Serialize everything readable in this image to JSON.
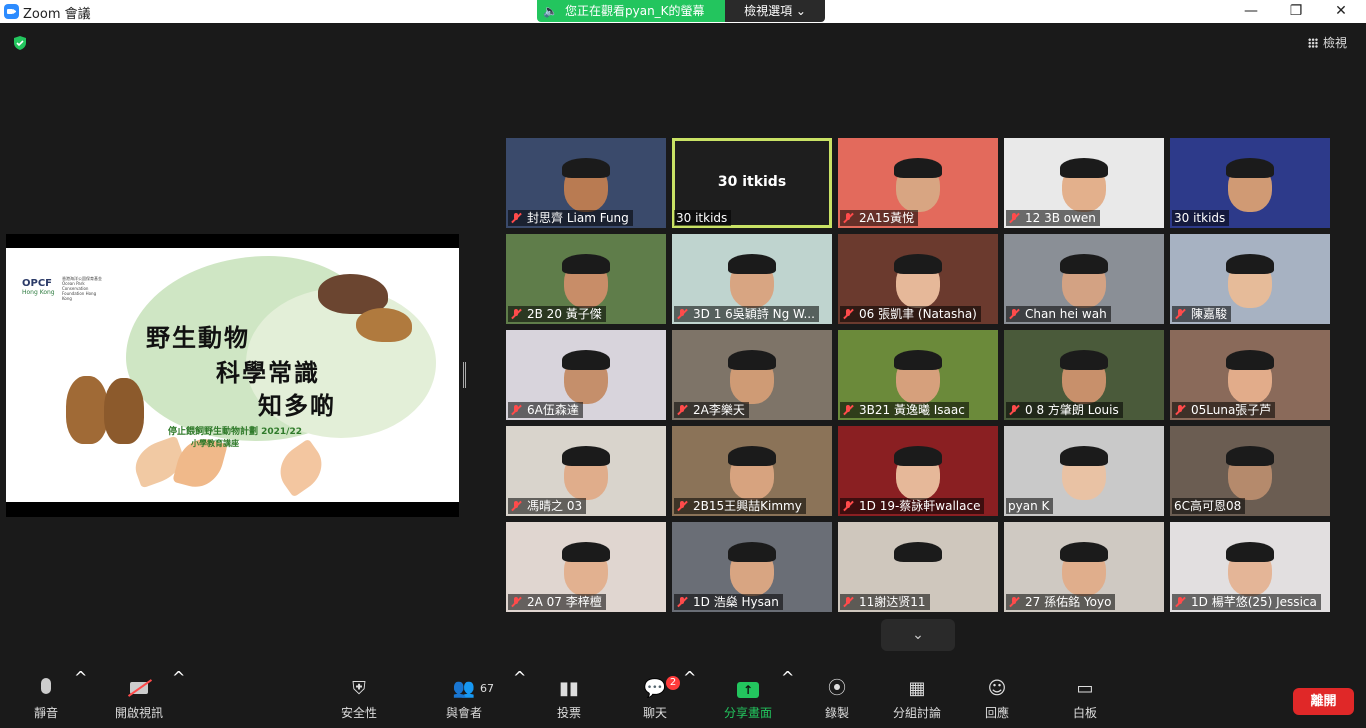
{
  "window": {
    "title": "Zoom 會議",
    "minimize": "—",
    "maximize": "❐",
    "close": "✕"
  },
  "share_banner": {
    "text": "您正在觀看pyan_K的螢幕",
    "view_options": "檢視選項 ⌄"
  },
  "top_right": {
    "view_label": "檢視"
  },
  "slide": {
    "logo": "OPCF",
    "logo_sub": "Hong Kong",
    "logo_org": "香港海洋公園保育基金 Ocean Park Conservation Foundation Hong Kong",
    "title_line1": "野生動物",
    "title_line2": "科學常識",
    "title_line3": "知多啲",
    "subtitle1": "停止餵飼野生動物計劃 2021/22",
    "subtitle2": "小學教育講座"
  },
  "participants": [
    {
      "name": "封思齊 Liam Fung",
      "muted": true,
      "bg": "#3a4a6b",
      "skin": "#b97b52"
    },
    {
      "name": "30 itkids",
      "muted": false,
      "active": true,
      "center_name": "30 itkids",
      "bg": "#1e1e1e"
    },
    {
      "name": "2A15黃悅",
      "muted": true,
      "bg": "#e36a5c",
      "skin": "#d8a582"
    },
    {
      "name": "12 3B owen",
      "muted": true,
      "bg": "#e9e9e9",
      "skin": "#e3b08c"
    },
    {
      "name": "30 itkids",
      "muted": false,
      "bg": "#2d3a8a",
      "skin": "#d09a74"
    },
    {
      "name": "2B 20 黃子傑",
      "muted": true,
      "bg": "#5f7d4a",
      "skin": "#c88d68"
    },
    {
      "name": "3D 1 6吳穎詩 Ng W...",
      "muted": true,
      "bg": "#bfd4cf",
      "skin": "#d8a582"
    },
    {
      "name": "06 張凱聿 (Natasha)",
      "muted": true,
      "bg": "#6b3a2e",
      "skin": "#e6b899"
    },
    {
      "name": "Chan hei wah",
      "muted": true,
      "bg": "#8a8f96",
      "skin": "#d3a283"
    },
    {
      "name": "陳嘉駿",
      "muted": true,
      "bg": "#a7b2c2",
      "skin": "#e6bb99"
    },
    {
      "name": "6A伍森達",
      "muted": true,
      "bg": "#d8d4dc",
      "skin": "#c58f6b"
    },
    {
      "name": "2A李樂天",
      "muted": true,
      "bg": "#7e7468",
      "skin": "#cf9b75"
    },
    {
      "name": "3B21 黃逸曦 Isaac",
      "muted": true,
      "bg": "#6b8a3a",
      "skin": "#d6a07c"
    },
    {
      "name": "0 8 方肇朗 Louis",
      "muted": true,
      "bg": "#4a5a3a",
      "skin": "#c8906b"
    },
    {
      "name": "05Luna張子芦",
      "muted": true,
      "bg": "#8a6a5a",
      "skin": "#e2ac8a"
    },
    {
      "name": "馮晴之 03",
      "muted": true,
      "bg": "#d9d4cc",
      "skin": "#e0ad8b"
    },
    {
      "name": "2B15王興喆Kimmy",
      "muted": true,
      "bg": "#8b7358",
      "skin": "#d7a37f"
    },
    {
      "name": "1D 19-蔡詠軒wallace",
      "muted": true,
      "bg": "#8a1f22",
      "skin": "#e6b899"
    },
    {
      "name": "pyan K",
      "muted": false,
      "bg": "#c9c9c9",
      "skin": "#e9c2a4"
    },
    {
      "name": "6C高可恩08",
      "muted": false,
      "bg": "#6b5d52",
      "skin": "#b58a6c"
    },
    {
      "name": "2A 07 李梓檀",
      "muted": true,
      "bg": "#e0d6d0",
      "skin": "#e2b190"
    },
    {
      "name": "1D 浩燊 Hysan",
      "muted": true,
      "bg": "#6a6e76",
      "skin": "#d8a582"
    },
    {
      "name": "11謝达贤11",
      "muted": true,
      "bg": "#cfc7bd",
      "skin": "#cfc7bd"
    },
    {
      "name": "27 孫佑銘 Yoyo",
      "muted": true,
      "bg": "#cfc9c2",
      "skin": "#e0ae8c"
    },
    {
      "name": "1D 楊芊悠(25) Jessica",
      "muted": true,
      "bg": "#e2dfe0",
      "skin": "#e4b597"
    }
  ],
  "toolbar": {
    "mute": "靜音",
    "start_video": "開啟視訊",
    "security": "安全性",
    "participants": "與會者",
    "participant_count": "67",
    "polls": "投票",
    "chat": "聊天",
    "chat_badge": "2",
    "share_screen": "分享畫面",
    "record": "錄製",
    "breakout": "分組討論",
    "reactions": "回應",
    "whiteboard": "白板",
    "leave": "離開"
  },
  "colors": {
    "accent_green": "#23c55e",
    "active_speaker": "#c9e265",
    "leave_red": "#e02828",
    "badge_red": "#ff3b3b"
  },
  "icons": [
    "zoom-logo-icon",
    "speaker-icon",
    "shield-check-icon",
    "grid-icon",
    "mic-icon",
    "camera-off-icon",
    "shield-icon",
    "participants-icon",
    "poll-icon",
    "chat-icon",
    "share-screen-icon",
    "record-icon",
    "breakout-icon",
    "reaction-icon",
    "whiteboard-icon",
    "chevron-down-icon"
  ]
}
